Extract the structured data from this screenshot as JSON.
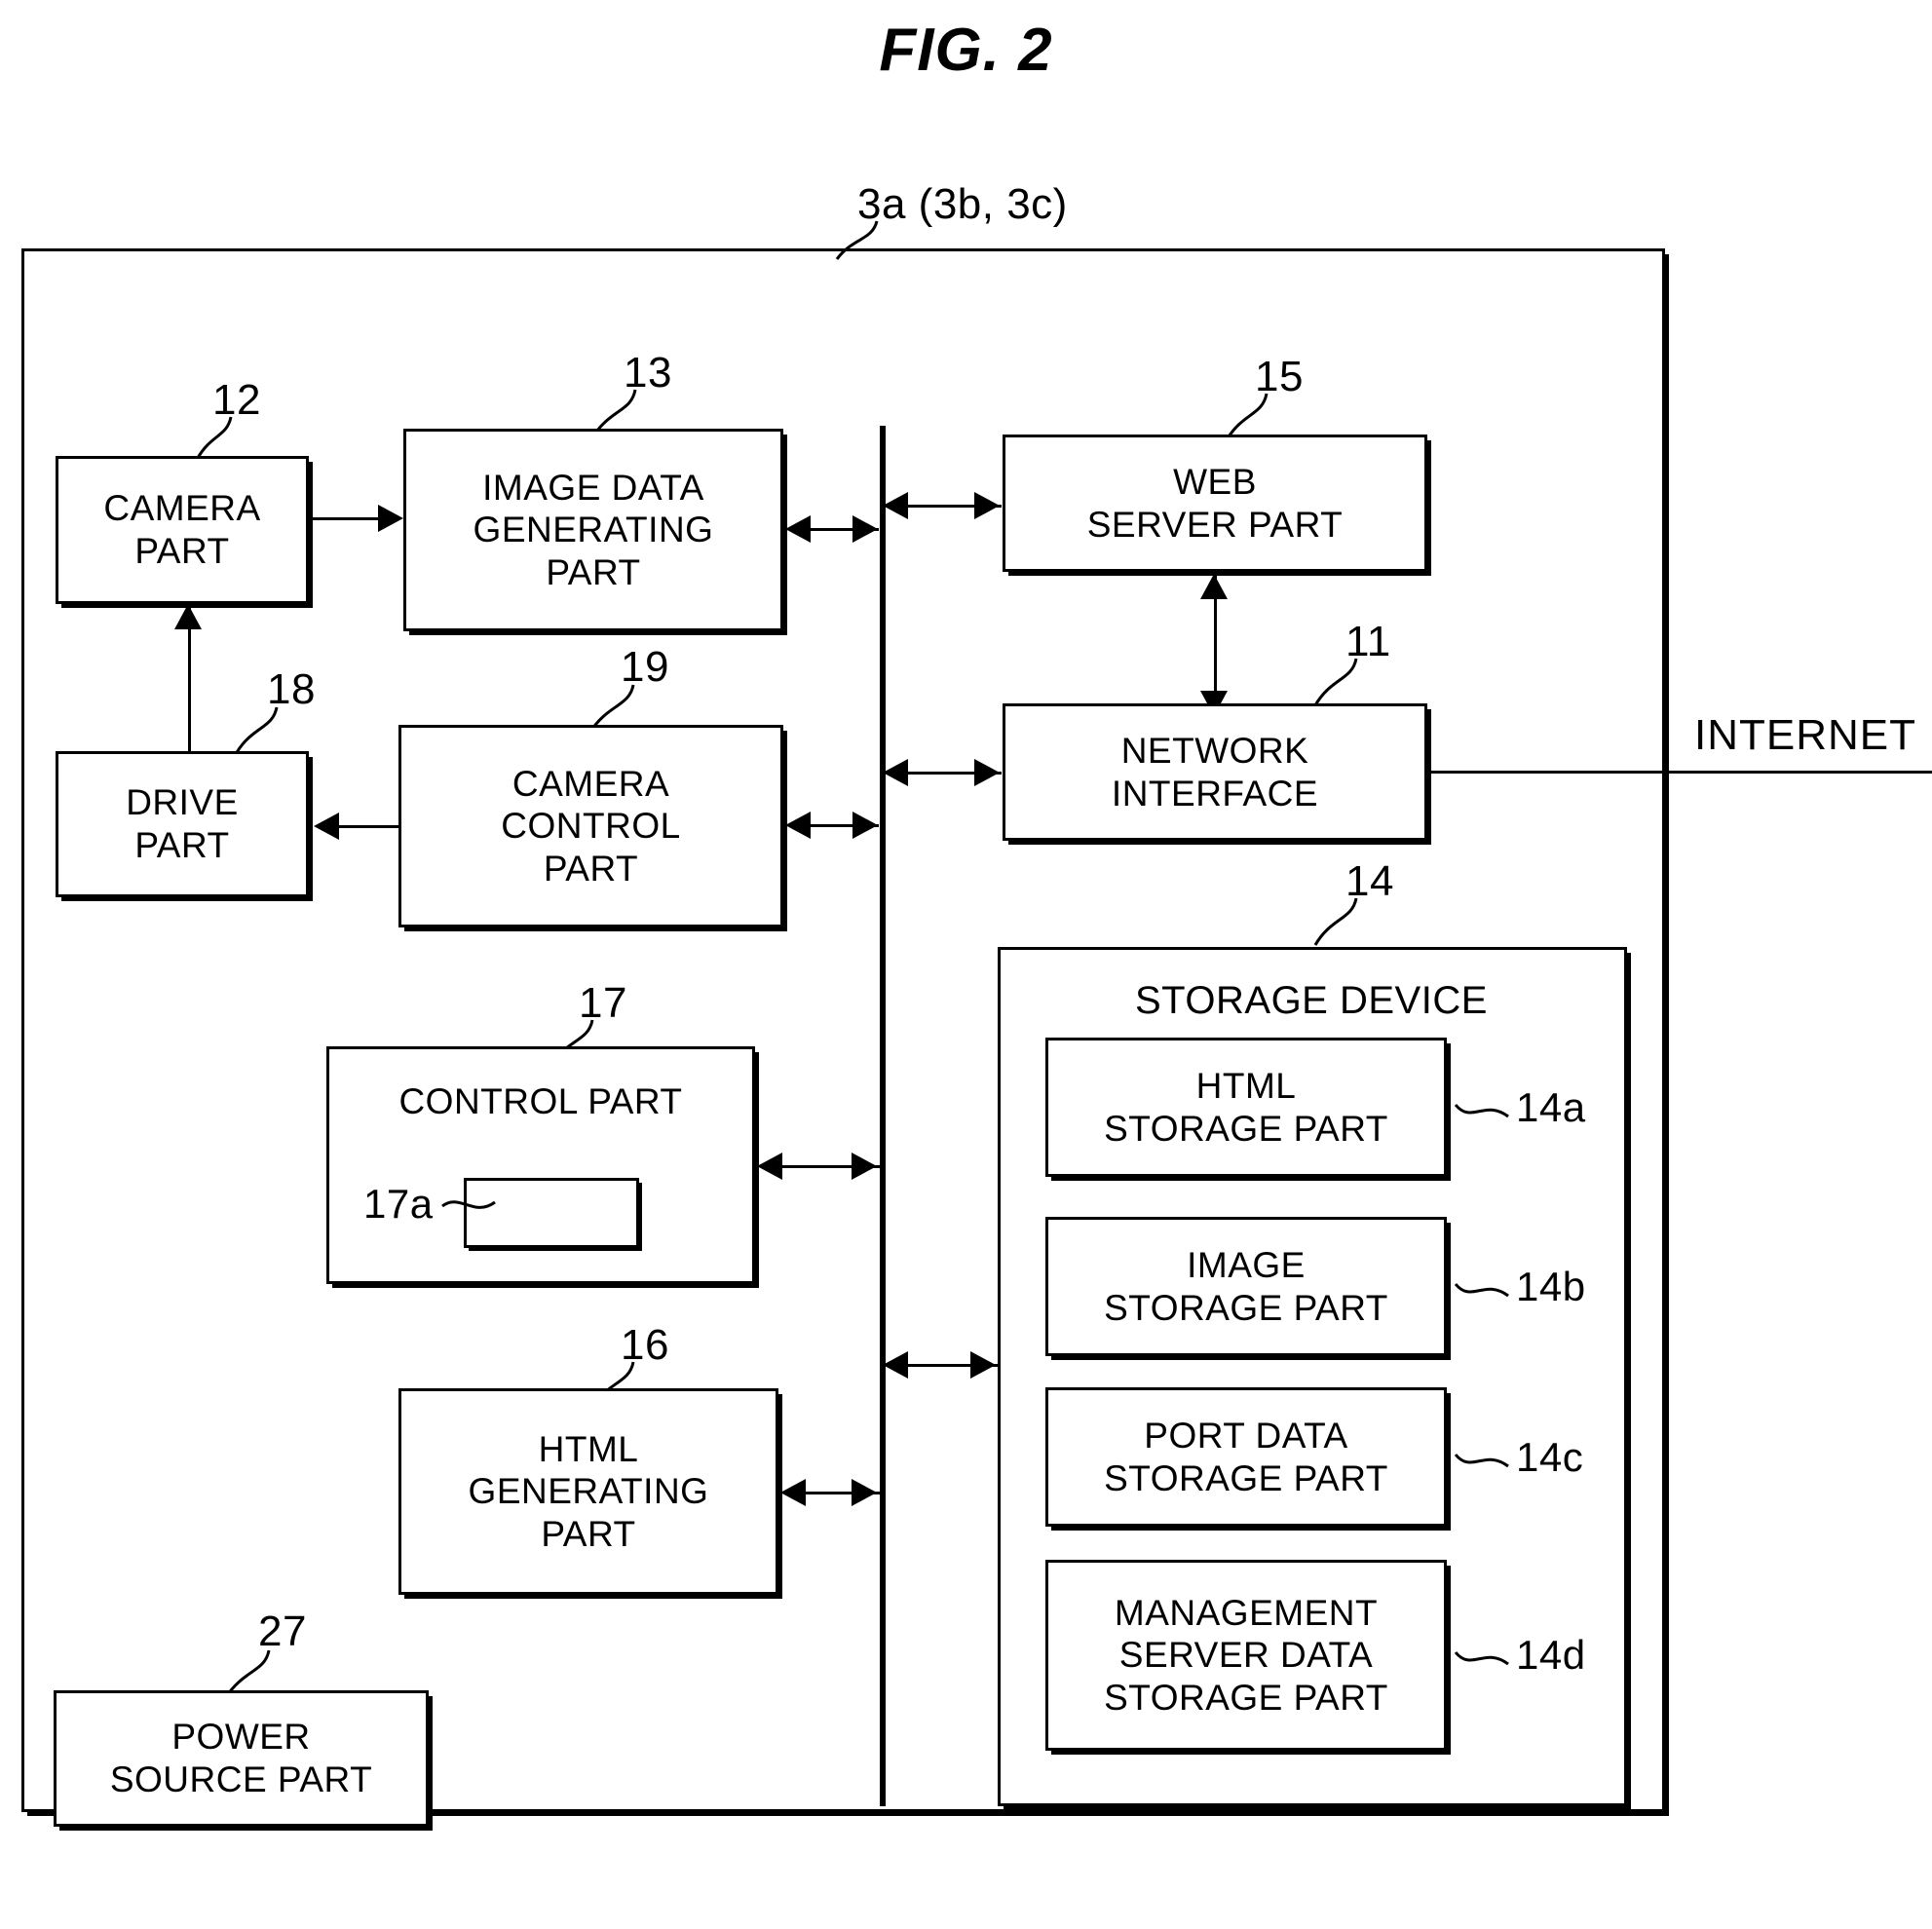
{
  "figure": {
    "title": "FIG. 2",
    "device_label": "3a (3b, 3c)",
    "internet_label": "INTERNET"
  },
  "blocks": [
    {
      "id": "camera",
      "ref": "12",
      "label": "CAMERA\nPART"
    },
    {
      "id": "image_data_gen",
      "ref": "13",
      "label": "IMAGE DATA\nGENERATING\nPART"
    },
    {
      "id": "web_server",
      "ref": "15",
      "label": "WEB\nSERVER PART"
    },
    {
      "id": "network_if",
      "ref": "11",
      "label": "NETWORK\nINTERFACE"
    },
    {
      "id": "drive",
      "ref": "18",
      "label": "DRIVE\nPART"
    },
    {
      "id": "camera_control",
      "ref": "19",
      "label": "CAMERA\nCONTROL\nPART"
    },
    {
      "id": "control",
      "ref": "17",
      "label": "CONTROL PART"
    },
    {
      "id": "control_inner",
      "ref": "17a",
      "label": ""
    },
    {
      "id": "html_gen",
      "ref": "16",
      "label": "HTML\nGENERATING\nPART"
    },
    {
      "id": "power_source",
      "ref": "27",
      "label": "POWER\nSOURCE PART"
    }
  ],
  "storage": {
    "ref": "14",
    "title": "STORAGE DEVICE",
    "parts": [
      {
        "ref": "14a",
        "label": "HTML\nSTORAGE PART"
      },
      {
        "ref": "14b",
        "label": "IMAGE\nSTORAGE PART"
      },
      {
        "ref": "14c",
        "label": "PORT DATA\nSTORAGE PART"
      },
      {
        "ref": "14d",
        "label": "MANAGEMENT\nSERVER DATA\nSTORAGE PART"
      }
    ]
  },
  "colors": {
    "stroke": "#000000",
    "background": "#ffffff"
  }
}
